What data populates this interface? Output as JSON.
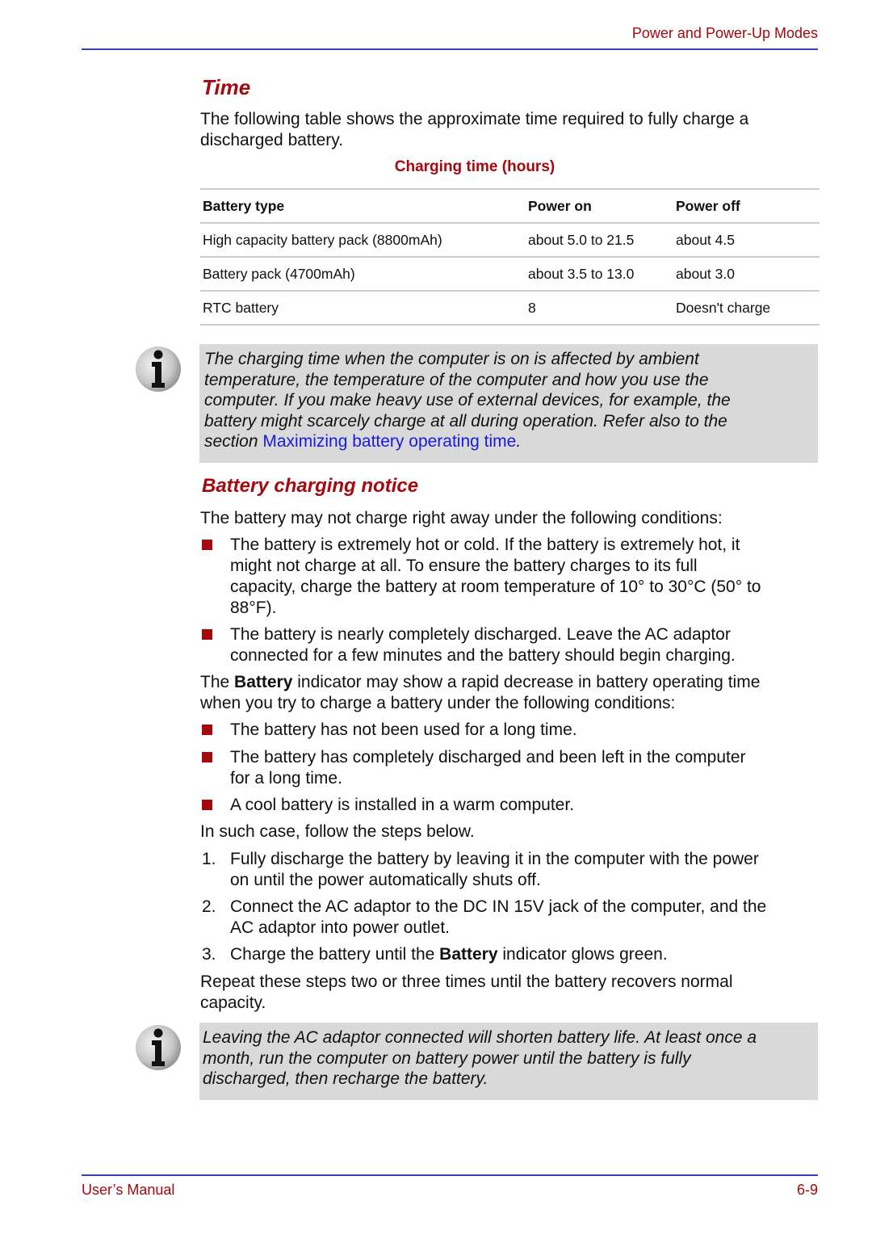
{
  "header": {
    "section_title": "Power and Power-Up Modes"
  },
  "time_section": {
    "heading": "Time",
    "intro_line1": "The following table shows the approximate time required to fully charge a",
    "intro_line2": "discharged battery.",
    "table_caption": "Charging time (hours)",
    "table": {
      "columns": [
        "Battery type",
        "Power on",
        "Power off"
      ],
      "rows": [
        [
          "High capacity battery pack (8800mAh)",
          "about 5.0 to 21.5",
          "about 4.5"
        ],
        [
          "Battery pack (4700mAh)",
          "about 3.5 to 13.0",
          "about 3.0"
        ],
        [
          "RTC battery",
          "8",
          "Doesn't charge"
        ]
      ]
    },
    "note": {
      "icon": "info-icon",
      "line1": "The charging time when the computer is on is affected by ambient",
      "line2": "temperature, the temperature of the computer and how you use the",
      "line3": "computer. If you make heavy use of external devices, for example, the",
      "line4": "battery might scarcely charge at all during operation. Refer also to the",
      "line5_prefix": "section ",
      "link_text": "Maximizing battery operating time",
      "line5_suffix": "."
    }
  },
  "notice_section": {
    "heading": "Battery charging notice",
    "intro": "The battery may not charge right away under the following conditions:",
    "conditions": [
      {
        "lines": [
          "The battery is extremely hot or cold. If the battery is extremely hot, it",
          "might not charge at all. To ensure the battery charges to its full",
          "capacity, charge the battery at room temperature of 10° to 30°C (50° to",
          "88°F)."
        ]
      },
      {
        "lines": [
          "The battery is nearly completely discharged. Leave the AC adaptor",
          "connected for a few minutes and the battery should begin charging."
        ]
      }
    ],
    "indicator_para": {
      "prefix": "The ",
      "bold": "Battery",
      "suffix": " indicator may show a rapid decrease in battery operating time",
      "line2": "when you try to charge a battery under the following conditions:"
    },
    "indicator_conditions": [
      {
        "lines": [
          "The battery has not been used for a long time."
        ]
      },
      {
        "lines": [
          "The battery has completely discharged and been left in the computer",
          "for a long time."
        ]
      },
      {
        "lines": [
          "A cool battery is installed in a warm computer."
        ]
      }
    ],
    "steps_intro": "In such case, follow the steps below.",
    "steps": [
      {
        "num": "1.",
        "lines": [
          "Fully discharge the battery by leaving it in the computer with the power",
          "on until the power automatically shuts off."
        ]
      },
      {
        "num": "2.",
        "lines": [
          "Connect the AC adaptor to the DC IN 15V jack of the computer, and the",
          "AC adaptor into power outlet."
        ]
      },
      {
        "num": "3.",
        "prefix": "Charge the battery until the ",
        "bold": "Battery",
        "suffix": " indicator glows green."
      }
    ],
    "repeat_line1": "Repeat these steps two or three times until the battery recovers normal",
    "repeat_line2": "capacity.",
    "note": {
      "icon": "info-icon",
      "line1": "Leaving the AC adaptor connected will shorten battery life. At least once a",
      "line2": "month, run the computer on battery power until the battery is fully",
      "line3": "discharged, then recharge the battery."
    }
  },
  "footer": {
    "left": "User’s Manual",
    "page": "6-9"
  },
  "colors": {
    "accent_red": "#a3090f",
    "rule_blue": "#3a42b0",
    "note_bg": "#d9d9d9",
    "link_blue": "#1a1adf"
  }
}
